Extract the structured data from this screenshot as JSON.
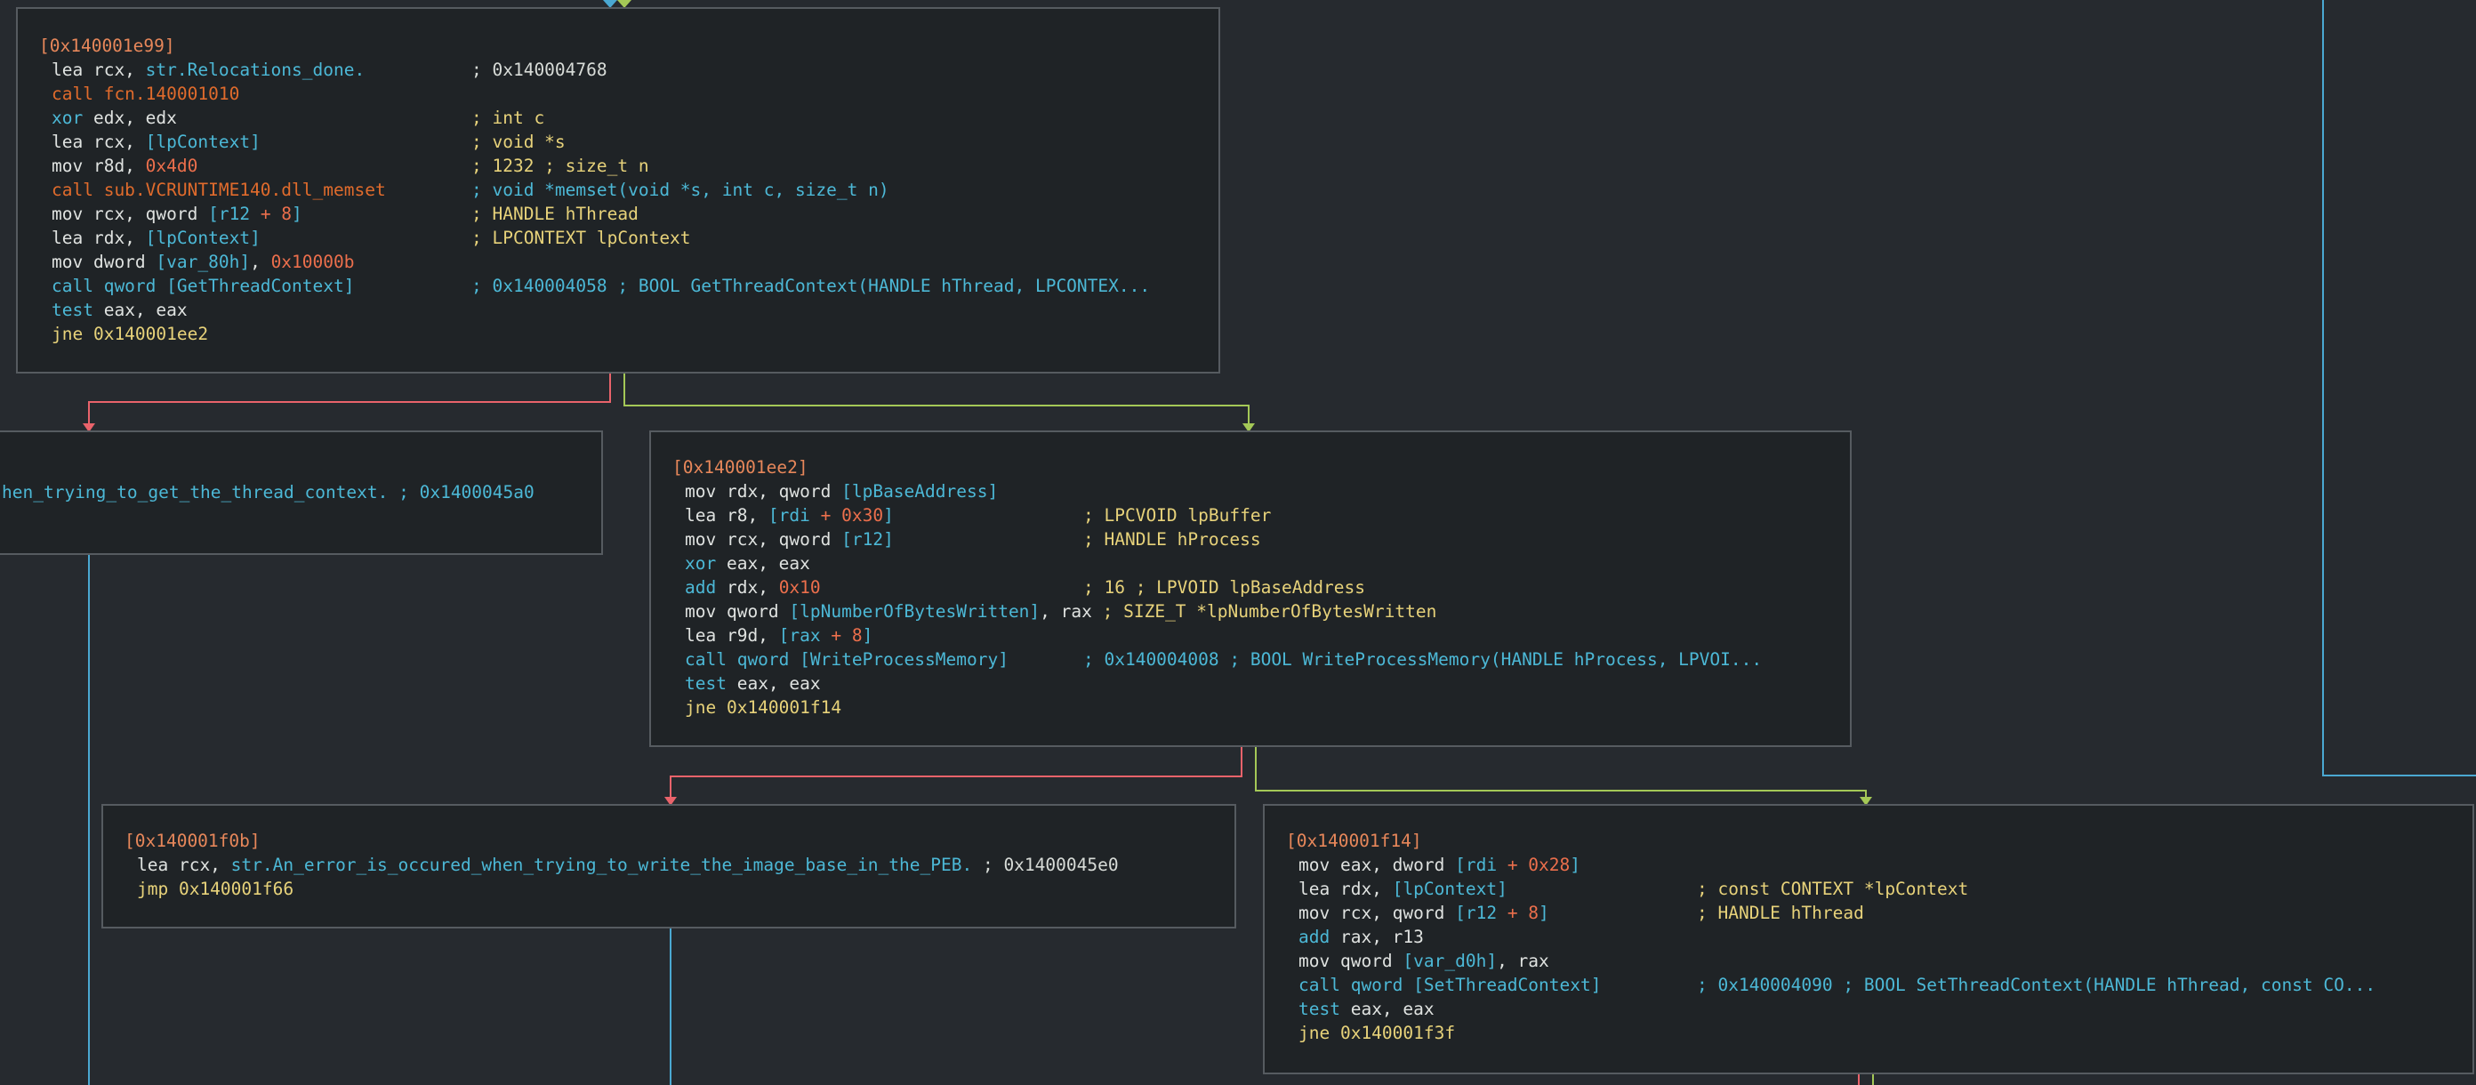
{
  "app": {
    "name": "radare2 / Cutter graph view"
  },
  "colors": {
    "background": "#262a2f",
    "node_background": "#1f2326",
    "node_border": "#565b60",
    "edge_true": "#a4c857",
    "edge_false": "#e9636b",
    "edge_jump": "#4aa8d2",
    "address_label": "#e7875a",
    "call": "#e06b2c",
    "register_text": "#dfe2e0",
    "immediate": "#e06b2c",
    "comment": "#e7d27a",
    "symbol": "#4cb8d6"
  },
  "nodes": [
    {
      "id": "n1e99",
      "label": "[0x140001e99]",
      "lines": [
        {
          "instr": "lea rcx, str.Relocations_done.",
          "comment": "; 0x140004768"
        },
        {
          "instr": "call fcn.140001010",
          "comment": ""
        },
        {
          "instr": "xor edx, edx",
          "comment": "; int c"
        },
        {
          "instr": "lea rcx, [lpContext]",
          "comment": "; void *s"
        },
        {
          "instr": "mov r8d, 0x4d0",
          "comment": "; 1232 ; size_t n"
        },
        {
          "instr": "call sub.VCRUNTIME140.dll_memset",
          "comment": "; void *memset(void *s, int c, size_t n)"
        },
        {
          "instr": "mov rcx, qword [r12 + 8]",
          "comment": "; HANDLE hThread"
        },
        {
          "instr": "lea rdx, [lpContext]",
          "comment": "; LPCONTEXT lpContext"
        },
        {
          "instr": "mov dword [var_80h], 0x10000b",
          "comment": ""
        },
        {
          "instr": "call qword [GetThreadContext]",
          "comment": "; 0x140004058 ; BOOL GetThreadContext(HANDLE hThread, LPCONTEX..."
        },
        {
          "instr": "test eax, eax",
          "comment": ""
        },
        {
          "instr": "jne 0x140001ee2",
          "comment": ""
        }
      ]
    },
    {
      "id": "nleft",
      "label": "",
      "lines": [
        {
          "instr": "hen_trying_to_get_the_thread_context. ; 0x1400045a0",
          "comment": ""
        }
      ]
    },
    {
      "id": "n1ee2",
      "label": "[0x140001ee2]",
      "lines": [
        {
          "instr": "mov rdx, qword [lpBaseAddress]",
          "comment": ""
        },
        {
          "instr": "lea r8, [rdi + 0x30]",
          "comment": "; LPCVOID lpBuffer"
        },
        {
          "instr": "mov rcx, qword [r12]",
          "comment": "; HANDLE hProcess"
        },
        {
          "instr": "xor eax, eax",
          "comment": ""
        },
        {
          "instr": "add rdx, 0x10",
          "comment": "; 16 ; LPVOID lpBaseAddress"
        },
        {
          "instr": "mov qword [lpNumberOfBytesWritten], rax",
          "comment": "; SIZE_T *lpNumberOfBytesWritten"
        },
        {
          "instr": "lea r9d, [rax + 8]",
          "comment": ""
        },
        {
          "instr": "call qword [WriteProcessMemory]",
          "comment": "; 0x140004008 ; BOOL WriteProcessMemory(HANDLE hProcess, LPVOI..."
        },
        {
          "instr": "test eax, eax",
          "comment": ""
        },
        {
          "instr": "jne 0x140001f14",
          "comment": ""
        }
      ]
    },
    {
      "id": "n1f0b",
      "label": "[0x140001f0b]",
      "lines": [
        {
          "instr": "lea rcx, str.An_error_is_occured_when_trying_to_write_the_image_base_in_the_PEB.",
          "comment": "; 0x1400045e0"
        },
        {
          "instr": "jmp 0x140001f66",
          "comment": ""
        }
      ]
    },
    {
      "id": "n1f14",
      "label": "[0x140001f14]",
      "lines": [
        {
          "instr": "mov eax, dword [rdi + 0x28]",
          "comment": ""
        },
        {
          "instr": "lea rdx, [lpContext]",
          "comment": "; const CONTEXT *lpContext"
        },
        {
          "instr": "mov rcx, qword [r12 + 8]",
          "comment": "; HANDLE hThread"
        },
        {
          "instr": "add rax, r13",
          "comment": ""
        },
        {
          "instr": "mov qword [var_d0h], rax",
          "comment": ""
        },
        {
          "instr": "call qword [SetThreadContext]",
          "comment": "; 0x140004090 ; BOOL SetThreadContext(HANDLE hThread, const CO..."
        },
        {
          "instr": "test eax, eax",
          "comment": ""
        },
        {
          "instr": "jne 0x140001f3f",
          "comment": ""
        }
      ]
    }
  ]
}
